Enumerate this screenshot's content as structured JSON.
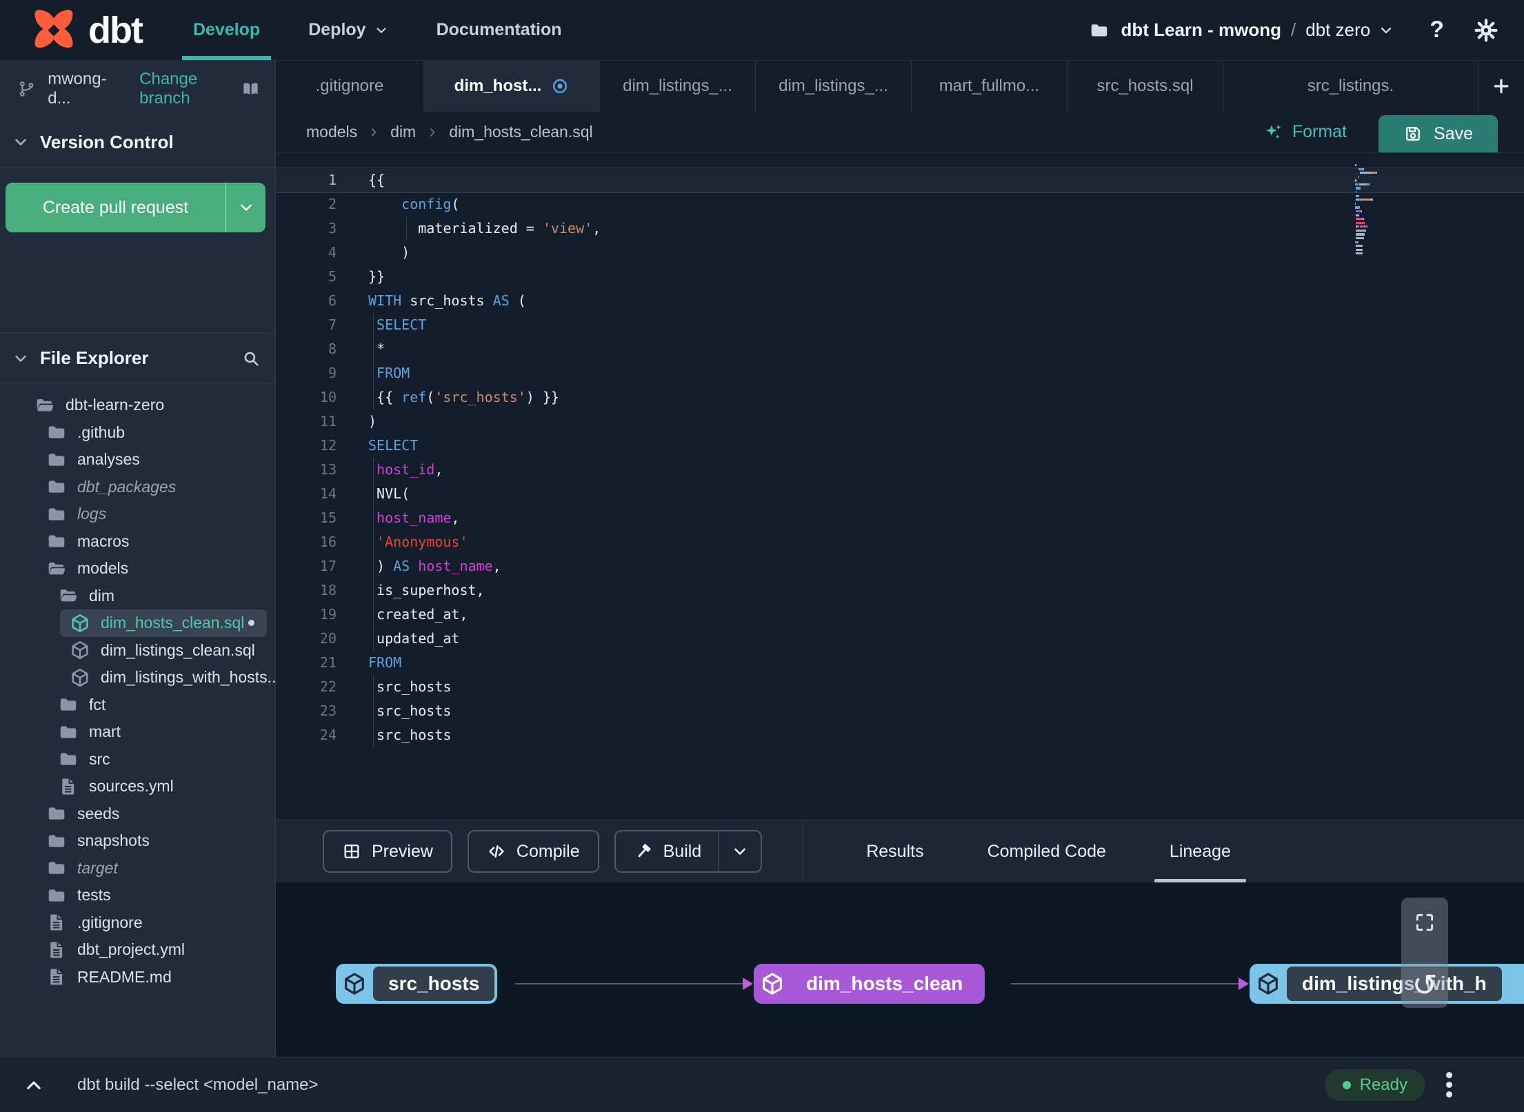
{
  "navbar": {
    "brand": "dbt",
    "items": [
      {
        "label": "Develop",
        "active": true
      },
      {
        "label": "Deploy",
        "dropdown": true
      },
      {
        "label": "Documentation"
      }
    ],
    "project_label": "dbt Learn - mwong",
    "project_separator": "/",
    "project_name": "dbt zero",
    "help_label": "?"
  },
  "sidebar": {
    "branch_name": "mwong-d...",
    "change_branch_label": "Change branch",
    "version_control_label": "Version Control",
    "create_pr_label": "Create pull request",
    "file_explorer_label": "File Explorer",
    "tree": [
      {
        "label": "dbt-learn-zero",
        "icon": "folderOpen",
        "depth": 0
      },
      {
        "label": ".github",
        "icon": "folder",
        "depth": 1
      },
      {
        "label": "analyses",
        "icon": "folder",
        "depth": 1
      },
      {
        "label": "dbt_packages",
        "icon": "folder",
        "depth": 1,
        "italic": true
      },
      {
        "label": "logs",
        "icon": "folder",
        "depth": 1,
        "italic": true
      },
      {
        "label": "macros",
        "icon": "folder",
        "depth": 1
      },
      {
        "label": "models",
        "icon": "folderOpen",
        "depth": 1
      },
      {
        "label": "dim",
        "icon": "folderOpen",
        "depth": 2
      },
      {
        "label": "dim_hosts_clean.sql",
        "icon": "cube",
        "depth": 3,
        "selected": true
      },
      {
        "label": "dim_listings_clean.sql",
        "icon": "cube",
        "depth": 3
      },
      {
        "label": "dim_listings_with_hosts...",
        "icon": "cube",
        "depth": 3
      },
      {
        "label": "fct",
        "icon": "folder",
        "depth": 2
      },
      {
        "label": "mart",
        "icon": "folder",
        "depth": 2
      },
      {
        "label": "src",
        "icon": "folder",
        "depth": 2
      },
      {
        "label": "sources.yml",
        "icon": "file",
        "depth": 2
      },
      {
        "label": "seeds",
        "icon": "folder",
        "depth": 1
      },
      {
        "label": "snapshots",
        "icon": "folder",
        "depth": 1
      },
      {
        "label": "target",
        "icon": "folder",
        "depth": 1,
        "italic": true
      },
      {
        "label": "tests",
        "icon": "folder",
        "depth": 1
      },
      {
        "label": ".gitignore",
        "icon": "file",
        "depth": 1
      },
      {
        "label": "dbt_project.yml",
        "icon": "file",
        "depth": 1
      },
      {
        "label": "README.md",
        "icon": "file",
        "depth": 1
      }
    ]
  },
  "tabs": [
    {
      "label": ".gitignore"
    },
    {
      "label": "dim_host...",
      "active": true,
      "unsaved": true
    },
    {
      "label": "dim_listings_..."
    },
    {
      "label": "dim_listings_..."
    },
    {
      "label": "mart_fullmo..."
    },
    {
      "label": "src_hosts.sql"
    },
    {
      "label": "src_listings."
    }
  ],
  "editor": {
    "breadcrumb": [
      "models",
      "dim",
      "dim_hosts_clean.sql"
    ],
    "format_label": "Format",
    "save_label": "Save",
    "code": [
      {
        "n": 1,
        "current": true,
        "tokens": [
          [
            "{{",
            "pl"
          ]
        ]
      },
      {
        "n": 2,
        "tokens": [
          [
            "    ",
            "pl"
          ],
          [
            "config",
            "fn"
          ],
          [
            "(",
            "pl"
          ]
        ]
      },
      {
        "n": 3,
        "guides": [
          5
        ],
        "tokens": [
          [
            "      ",
            "pl"
          ],
          [
            "materialized = ",
            "pl"
          ],
          [
            "'view'",
            "str"
          ],
          [
            ",",
            "pl"
          ]
        ]
      },
      {
        "n": 4,
        "tokens": [
          [
            "    )",
            "pl"
          ]
        ]
      },
      {
        "n": 5,
        "tokens": [
          [
            "}}",
            "pl"
          ]
        ]
      },
      {
        "n": 6,
        "tokens": [
          [
            "WITH",
            "kw"
          ],
          [
            " src_hosts ",
            "pl"
          ],
          [
            "AS",
            "kw"
          ],
          [
            " (",
            "pl"
          ]
        ]
      },
      {
        "n": 7,
        "guides": [
          1
        ],
        "tokens": [
          [
            " ",
            "pl"
          ],
          [
            "SELECT",
            "kw"
          ]
        ]
      },
      {
        "n": 8,
        "guides": [
          1
        ],
        "tokens": [
          [
            " *",
            "pl"
          ]
        ]
      },
      {
        "n": 9,
        "guides": [
          1
        ],
        "tokens": [
          [
            " ",
            "pl"
          ],
          [
            "FROM",
            "kw"
          ]
        ]
      },
      {
        "n": 10,
        "guides": [
          1
        ],
        "tokens": [
          [
            " {{ ",
            "pl"
          ],
          [
            "ref",
            "fn"
          ],
          [
            "(",
            "pl"
          ],
          [
            "'src_hosts'",
            "str"
          ],
          [
            ") }}",
            "pl"
          ]
        ]
      },
      {
        "n": 11,
        "tokens": [
          [
            ")",
            "pl"
          ]
        ]
      },
      {
        "n": 12,
        "tokens": [
          [
            "SELECT",
            "kw"
          ]
        ]
      },
      {
        "n": 13,
        "guides": [
          1
        ],
        "tokens": [
          [
            " ",
            "pl"
          ],
          [
            "host_id",
            "id"
          ],
          [
            ",",
            "pl"
          ]
        ]
      },
      {
        "n": 14,
        "guides": [
          1
        ],
        "tokens": [
          [
            " NVL(",
            "pl"
          ]
        ]
      },
      {
        "n": 15,
        "guides": [
          1
        ],
        "tokens": [
          [
            " ",
            "pl"
          ],
          [
            "host_name",
            "id"
          ],
          [
            ",",
            "pl"
          ]
        ]
      },
      {
        "n": 16,
        "guides": [
          1
        ],
        "tokens": [
          [
            " ",
            "pl"
          ],
          [
            "'Anonymous'",
            "str2"
          ]
        ]
      },
      {
        "n": 17,
        "guides": [
          1
        ],
        "tokens": [
          [
            " ) ",
            "pl"
          ],
          [
            "AS",
            "kw"
          ],
          [
            " ",
            "pl"
          ],
          [
            "host_name",
            "id"
          ],
          [
            ",",
            "pl"
          ]
        ]
      },
      {
        "n": 18,
        "guides": [
          1
        ],
        "tokens": [
          [
            " is_superhost,",
            "pl"
          ]
        ]
      },
      {
        "n": 19,
        "guides": [
          1
        ],
        "tokens": [
          [
            " created_at,",
            "pl"
          ]
        ]
      },
      {
        "n": 20,
        "guides": [
          1
        ],
        "tokens": [
          [
            " updated_at",
            "pl"
          ]
        ]
      },
      {
        "n": 21,
        "tokens": [
          [
            "FROM",
            "kw"
          ]
        ]
      },
      {
        "n": 22,
        "guides": [
          1
        ],
        "tokens": [
          [
            " src_hosts",
            "pl"
          ]
        ]
      },
      {
        "n": 23,
        "guides": [
          1
        ],
        "tokens": [
          [
            " src_hosts",
            "pl"
          ]
        ]
      },
      {
        "n": 24,
        "guides": [
          1
        ],
        "tokens": [
          [
            " src_hosts",
            "pl"
          ]
        ]
      }
    ]
  },
  "toolbar": {
    "preview_label": "Preview",
    "compile_label": "Compile",
    "build_label": "Build",
    "tabs": [
      {
        "label": "Results"
      },
      {
        "label": "Compiled Code"
      },
      {
        "label": "Lineage",
        "active": true
      }
    ]
  },
  "lineage": {
    "nodes": [
      {
        "label": "src_hosts",
        "variant": "seed"
      },
      {
        "label": "dim_hosts_clean",
        "variant": "model"
      },
      {
        "label": "dim_listings_with_h",
        "variant": "seed"
      }
    ]
  },
  "statusbar": {
    "command": "dbt build --select <model_name>",
    "status_label": "Ready"
  },
  "colors": {
    "accent_teal": "#3cb9ae",
    "brand_orange": "#ff5c3c",
    "node_blue": "#7cc3e8",
    "node_purple": "#a958d8",
    "status_green": "#57cc8d",
    "keyword_blue": "#5da2dc",
    "string_salmon": "#c88d6d",
    "string_red": "#e2493e",
    "identifier_magenta": "#d63fd6"
  }
}
